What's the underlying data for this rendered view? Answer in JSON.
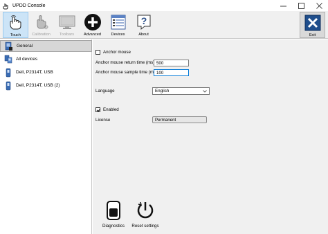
{
  "window": {
    "title": "UPDD Console"
  },
  "toolbar": {
    "touch": "Touch",
    "calibration": "Calibration",
    "toolbars": "Toolbars",
    "advanced": "Advanced",
    "devices": "Devices",
    "about": "About",
    "exit": "Exit"
  },
  "tree": {
    "items": [
      {
        "label": "General"
      },
      {
        "label": "All devices"
      },
      {
        "label": "Dell, P2314T, USB"
      },
      {
        "label": "Dell, P2314T, USB (2)"
      }
    ]
  },
  "settings": {
    "anchor_mouse": "Anchor mouse",
    "return_time_label": "Anchor mouse return time (ms)",
    "return_time_value": "500",
    "sample_time_label": "Anchor mouse sample time (ms)",
    "sample_time_value": "100",
    "language_label": "Language",
    "language_value": "English",
    "enabled_label": "Enabled",
    "license_label": "License",
    "license_value": "Permanent"
  },
  "actions": {
    "diagnostics": "Diagnostics",
    "reset": "Reset settings"
  },
  "colors": {
    "selected_toolbar": "#cce4f7",
    "focus_border": "#0078d7",
    "content_bg": "#f0f0f0"
  }
}
